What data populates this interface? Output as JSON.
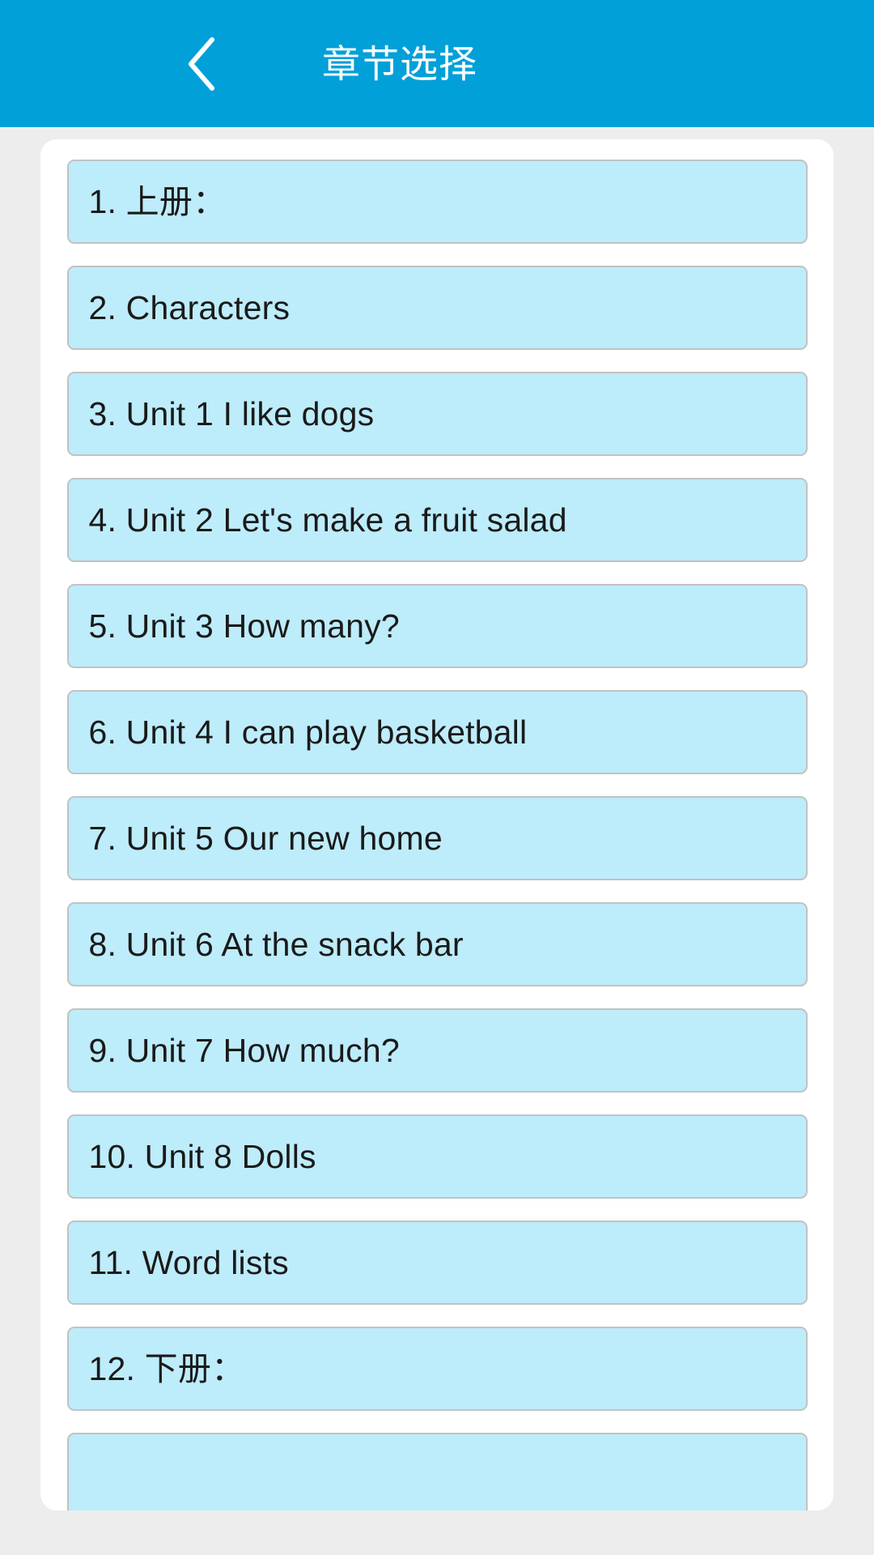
{
  "header": {
    "title": "章节选择",
    "back_icon": "chevron-left-icon",
    "background_color": "#02A0D8",
    "text_color": "#FFFFFF"
  },
  "theme": {
    "page_background": "#EDEDED",
    "card_background": "#FFFFFF",
    "item_background": "#BDECFB",
    "item_border": "#C2C2C2",
    "item_text": "#1A1A1A"
  },
  "chapters": [
    {
      "index": "1",
      "label": "1. 上册："
    },
    {
      "index": "2",
      "label": "2. Characters"
    },
    {
      "index": "3",
      "label": "3. Unit 1 I like dogs"
    },
    {
      "index": "4",
      "label": "4. Unit 2 Let's make a fruit salad"
    },
    {
      "index": "5",
      "label": "5. Unit 3 How many?"
    },
    {
      "index": "6",
      "label": "6. Unit 4 I can play basketball"
    },
    {
      "index": "7",
      "label": "7. Unit 5 Our new home"
    },
    {
      "index": "8",
      "label": "8. Unit 6 At the snack bar"
    },
    {
      "index": "9",
      "label": "9. Unit 7 How much?"
    },
    {
      "index": "10",
      "label": "10. Unit 8 Dolls"
    },
    {
      "index": "11",
      "label": "11. Word lists"
    },
    {
      "index": "12",
      "label": "12. 下册："
    },
    {
      "index": "13",
      "label": ""
    }
  ]
}
